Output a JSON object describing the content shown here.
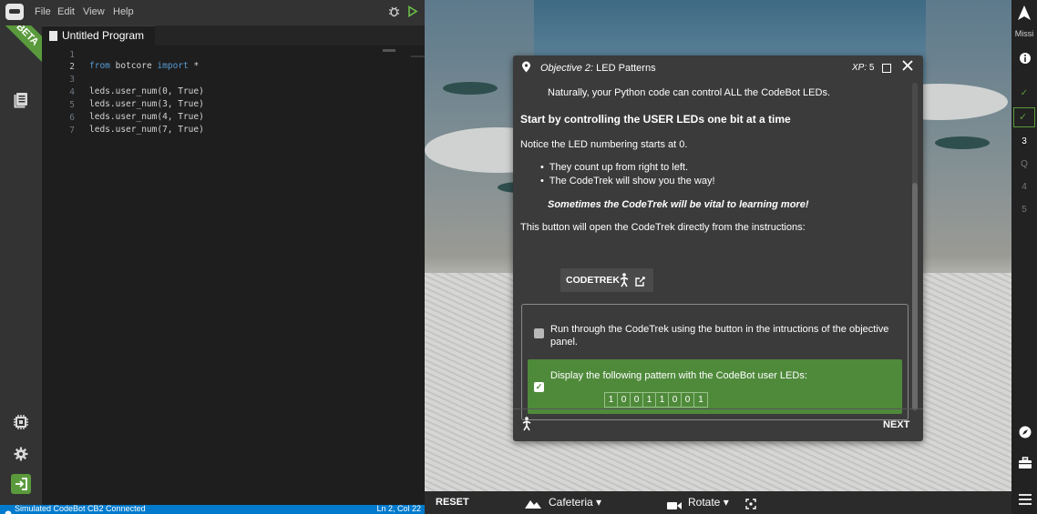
{
  "menu": {
    "items": [
      "File",
      "Edit",
      "View",
      "Help"
    ]
  },
  "beta_badge": "BETA",
  "tab": {
    "title": "Untitled Program"
  },
  "editor": {
    "lines": [
      {
        "n": "1",
        "code": ""
      },
      {
        "n": "2",
        "code": "from botcore import *"
      },
      {
        "n": "3",
        "code": ""
      },
      {
        "n": "4",
        "code": "leds.user_num(0, True)"
      },
      {
        "n": "5",
        "code": "leds.user_num(3, True)"
      },
      {
        "n": "6",
        "code": "leds.user_num(4, True)"
      },
      {
        "n": "7",
        "code": "leds.user_num(7, True)"
      }
    ]
  },
  "status": {
    "connection": "Simulated CodeBot CB2 Connected",
    "cursor": "Ln 2, Col 22"
  },
  "objective": {
    "title_italic": "Objective 2:",
    "title": "LED Patterns",
    "xp_label": "XP:",
    "xp_value": "5",
    "intro": "Naturally, your Python code can control ALL the CodeBot LEDs.",
    "heading": "Start by controlling the USER LEDs one bit at a time",
    "numbering": "Notice the LED numbering starts at 0.",
    "bullet1": "They count up from right to left.",
    "bullet2": "The CodeTrek will show you the way!",
    "vital": "Sometimes the CodeTrek will be vital to learning more!",
    "button_intro": "This button will open the CodeTrek directly from the instructions:",
    "codetrek_label": "CODETREK",
    "task1": "Run through the CodeTrek using the button in the intructions of the objective panel.",
    "task2": "Display the following pattern with the CodeBot user LEDs:",
    "led_pattern": [
      "1",
      "0",
      "0",
      "1",
      "1",
      "0",
      "0",
      "1"
    ],
    "next_label": "NEXT"
  },
  "bottombar": {
    "reset": "RESET",
    "location": "Cafeteria",
    "camera": "Rotate"
  },
  "rail": {
    "title": "Missi",
    "items": [
      "3",
      "Q",
      "4",
      "5"
    ]
  },
  "colors": {
    "accent_green": "#4f8a3b",
    "status_blue": "#007acc",
    "beta_green": "#5a9a3c"
  }
}
